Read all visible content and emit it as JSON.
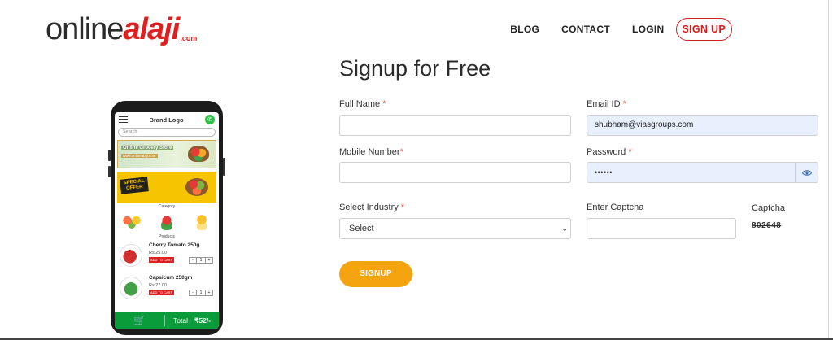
{
  "logo": {
    "part1": "online",
    "part2": "alaji",
    "suffix": ".com"
  },
  "nav": {
    "blog": "BLOG",
    "contact": "CONTACT",
    "login": "LOGIN",
    "signup": "SIGN UP"
  },
  "phone": {
    "brand": "Brand Logo",
    "search_placeholder": "Search",
    "banner1_title": "Online Grocery Store",
    "banner1_sub": "www.onlinealaji.com",
    "banner2_l1": "SPECIAL",
    "banner2_l2": "OFFER",
    "category_label": "Category",
    "products_label": "Products",
    "products": [
      {
        "name": "Cherry Tomato 250g",
        "price": "Rs 25.00",
        "add": "ADD TO CART",
        "qty": "1"
      },
      {
        "name": "Capsicum 250gm",
        "price": "Rs 27.00",
        "add": "ADD TO CART",
        "qty": "1"
      }
    ],
    "total_label": "Total",
    "total_amount": "₹52/-"
  },
  "form": {
    "title": "Signup for Free",
    "full_name_label": "Full Name",
    "email_label": "Email ID",
    "email_value": "shubham@viasgroups.com",
    "mobile_label": "Mobile Number",
    "password_label": "Password",
    "password_value": "••••••",
    "industry_label": "Select Industry",
    "industry_value": "Select",
    "captcha_input_label": "Enter Captcha",
    "captcha_label": "Captcha",
    "captcha_value": "802648",
    "required_mark": "*",
    "signup_button": "SIGNUP"
  },
  "colors": {
    "accent_red": "#d32020",
    "button_orange": "#f5a30e",
    "autofill_blue": "#e8f0fe",
    "phone_footer_green": "#0a9c3b"
  }
}
